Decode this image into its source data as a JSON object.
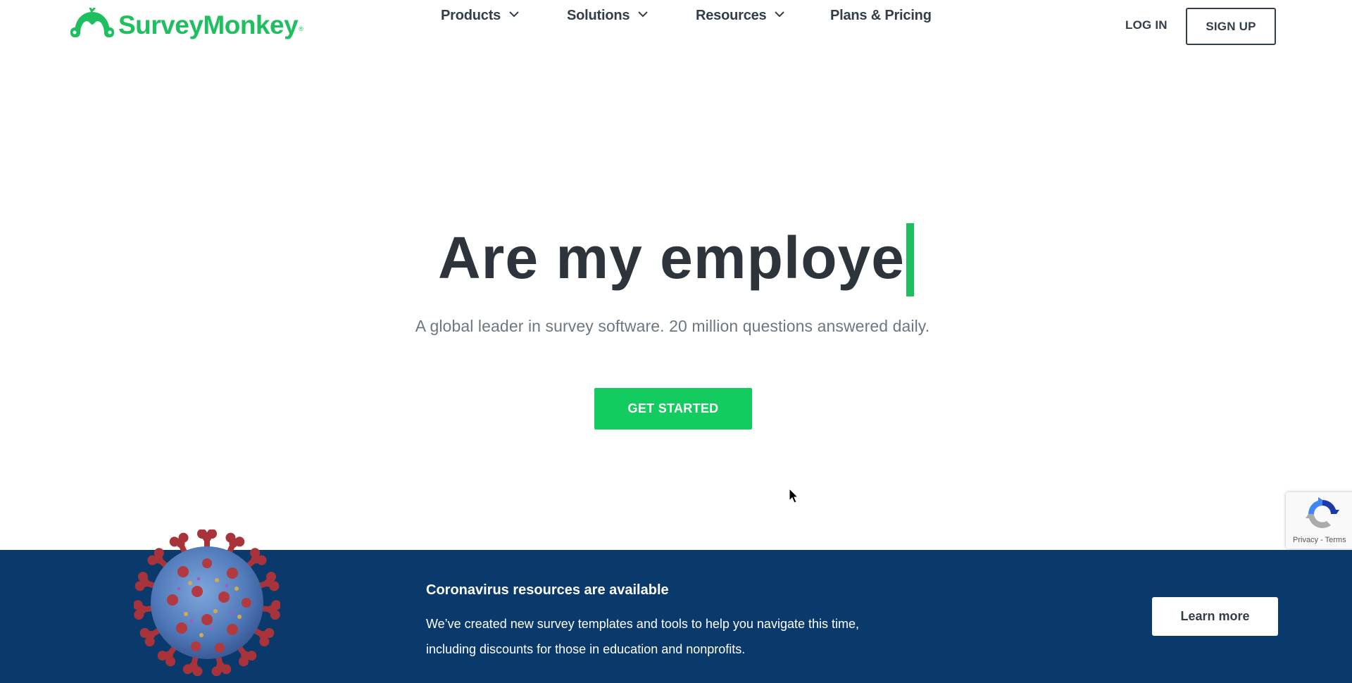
{
  "brand": {
    "name": "SurveyMonkey",
    "registered_mark": "®",
    "accent_color": "#1dbf5e",
    "icon": "surveymonkey-logo-icon"
  },
  "nav": {
    "items": [
      {
        "label": "Products",
        "has_dropdown": true,
        "icon": "chevron-down-icon"
      },
      {
        "label": "Solutions",
        "has_dropdown": true,
        "icon": "chevron-down-icon"
      },
      {
        "label": "Resources",
        "has_dropdown": true,
        "icon": "chevron-down-icon"
      },
      {
        "label": "Plans & Pricing",
        "has_dropdown": false
      }
    ],
    "login_label": "LOG IN",
    "signup_label": "SIGN UP"
  },
  "hero": {
    "title_typed": "Are my employe",
    "subtitle": "A global leader in survey software. 20 million questions answered daily.",
    "cta_label": "GET STARTED",
    "cta_color": "#12cc60",
    "cursor_color": "#1dbf5e"
  },
  "recaptcha": {
    "icon": "recaptcha-icon",
    "links": "Privacy - Terms"
  },
  "banner": {
    "background_color": "#0a3a6b",
    "image": "coronavirus-illustration",
    "title": "Coronavirus resources are available",
    "body_line1": "We’ve created new survey templates and tools to help you navigate this time,",
    "body_line2": "including discounts for those in education and nonprofits.",
    "button_label": "Learn more"
  }
}
